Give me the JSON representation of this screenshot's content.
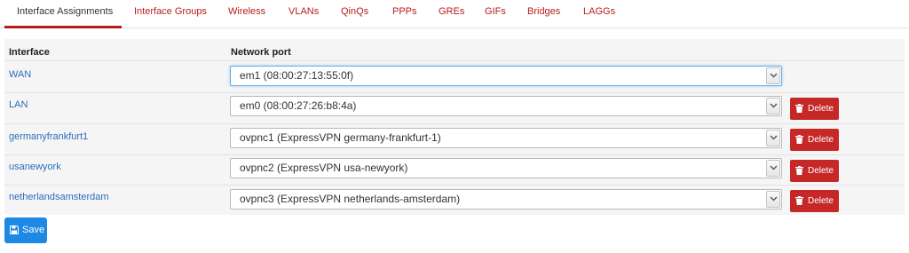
{
  "tabs": [
    {
      "label": "Interface Assignments",
      "active": true
    },
    {
      "label": "Interface Groups"
    },
    {
      "label": "Wireless"
    },
    {
      "label": "VLANs"
    },
    {
      "label": "QinQs"
    },
    {
      "label": "PPPs"
    },
    {
      "label": "GREs"
    },
    {
      "label": "GIFs"
    },
    {
      "label": "Bridges"
    },
    {
      "label": "LAGGs"
    }
  ],
  "table": {
    "headers": {
      "interface": "Interface",
      "network_port": "Network port"
    },
    "rows": [
      {
        "interface": "WAN",
        "port": "em1 (08:00:27:13:55:0f)",
        "delete": null
      },
      {
        "interface": "LAN",
        "port": "em0 (08:00:27:26:b8:4a)",
        "delete": "Delete"
      },
      {
        "interface": "germanyfrankfurt1",
        "port": "ovpnc1 (ExpressVPN germany-frankfurt-1)",
        "delete": "Delete"
      },
      {
        "interface": "usanewyork",
        "port": "ovpnc2 (ExpressVPN usa-newyork)",
        "delete": "Delete"
      },
      {
        "interface": "netherlandsamsterdam",
        "port": "ovpnc3 (ExpressVPN netherlands-amsterdam)",
        "delete": "Delete"
      }
    ]
  },
  "save_label": "Save",
  "colors": {
    "tab_link": "#b71c1c",
    "link": "#2a6ebb",
    "delete": "#c62828",
    "save": "#1e88e5"
  },
  "icons": {
    "delete": "trash-icon",
    "save": "floppy-disk-icon",
    "select": "chevron-down-icon"
  }
}
